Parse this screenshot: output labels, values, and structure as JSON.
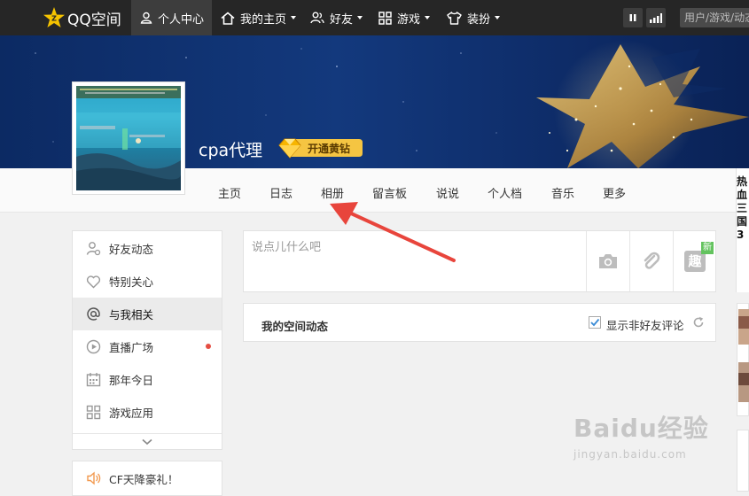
{
  "topbar": {
    "logo_text": "QQ空间",
    "nav": [
      {
        "label": "个人中心",
        "icon": "user-icon"
      },
      {
        "label": "我的主页",
        "icon": "home-icon"
      },
      {
        "label": "好友",
        "icon": "friends-icon"
      },
      {
        "label": "游戏",
        "icon": "grid-icon"
      },
      {
        "label": "装扮",
        "icon": "shirt-icon"
      }
    ],
    "search_placeholder": "用户/游戏/动态"
  },
  "profile": {
    "username": "cpa代理",
    "vip_label": "开通黄钻"
  },
  "subnav": [
    "主页",
    "日志",
    "相册",
    "留言板",
    "说说",
    "个人档",
    "音乐",
    "更多"
  ],
  "sidebar": {
    "items": [
      {
        "label": "好友动态",
        "icon": "friends-feed-icon"
      },
      {
        "label": "特别关心",
        "icon": "heart-icon"
      },
      {
        "label": "与我相关",
        "icon": "at-icon"
      },
      {
        "label": "直播广场",
        "icon": "play-icon"
      },
      {
        "label": "那年今日",
        "icon": "calendar-icon"
      },
      {
        "label": "游戏应用",
        "icon": "apps-icon"
      }
    ],
    "promo": "CF天降豪礼！"
  },
  "post": {
    "placeholder": "说点儿什么吧",
    "new_tag": "新",
    "fun_label": "趣"
  },
  "feed": {
    "title": "我的空间动态",
    "checkbox_label": "显示非好友评论"
  },
  "right_strip": {
    "text": "热血三国3"
  },
  "watermark": {
    "main": "Baidu经验",
    "sub": "jingyan.baidu.com"
  },
  "colors": {
    "topbar": "#262626",
    "banner": "#13397d",
    "vip_gold": "#f5c542",
    "annotation_red": "#e8453c"
  }
}
